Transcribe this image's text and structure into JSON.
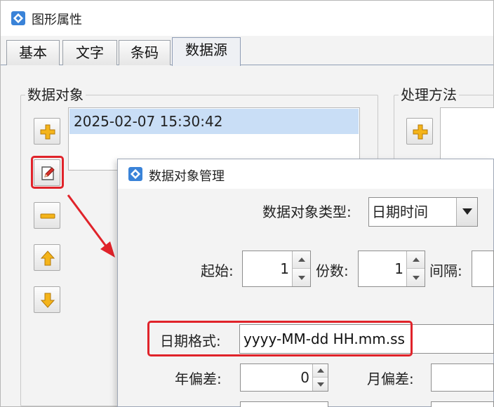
{
  "main_window": {
    "title": "图形属性",
    "tabs": [
      {
        "label": "基本"
      },
      {
        "label": "文字"
      },
      {
        "label": "条码"
      },
      {
        "label": "数据源"
      }
    ],
    "active_tab": "数据源"
  },
  "data_objects": {
    "group_title": "数据对象",
    "items": [
      "2025-02-07 15:30:42"
    ]
  },
  "processing": {
    "group_title": "处理方法"
  },
  "toolbar_icons": {
    "add": "plus-icon",
    "edit": "edit-icon",
    "remove": "minus-icon",
    "up": "arrow-up-icon",
    "down": "arrow-down-icon"
  },
  "dialog": {
    "title": "数据对象管理",
    "type_label": "数据对象类型:",
    "type_value": "日期时间",
    "start_label": "起始:",
    "start_value": "1",
    "copies_label": "份数:",
    "copies_value": "1",
    "interval_label": "间隔:",
    "interval_value": "",
    "date_format_label": "日期格式:",
    "date_format_value": "yyyy-MM-dd HH.mm.ss",
    "year_offset_label": "年偏差:",
    "year_offset_value": "0",
    "month_offset_label": "月偏差:",
    "month_offset_value": ""
  },
  "colors": {
    "highlight": "#e0232a",
    "selection": "#c9def6",
    "icon_yellow": "#f4b41a"
  }
}
